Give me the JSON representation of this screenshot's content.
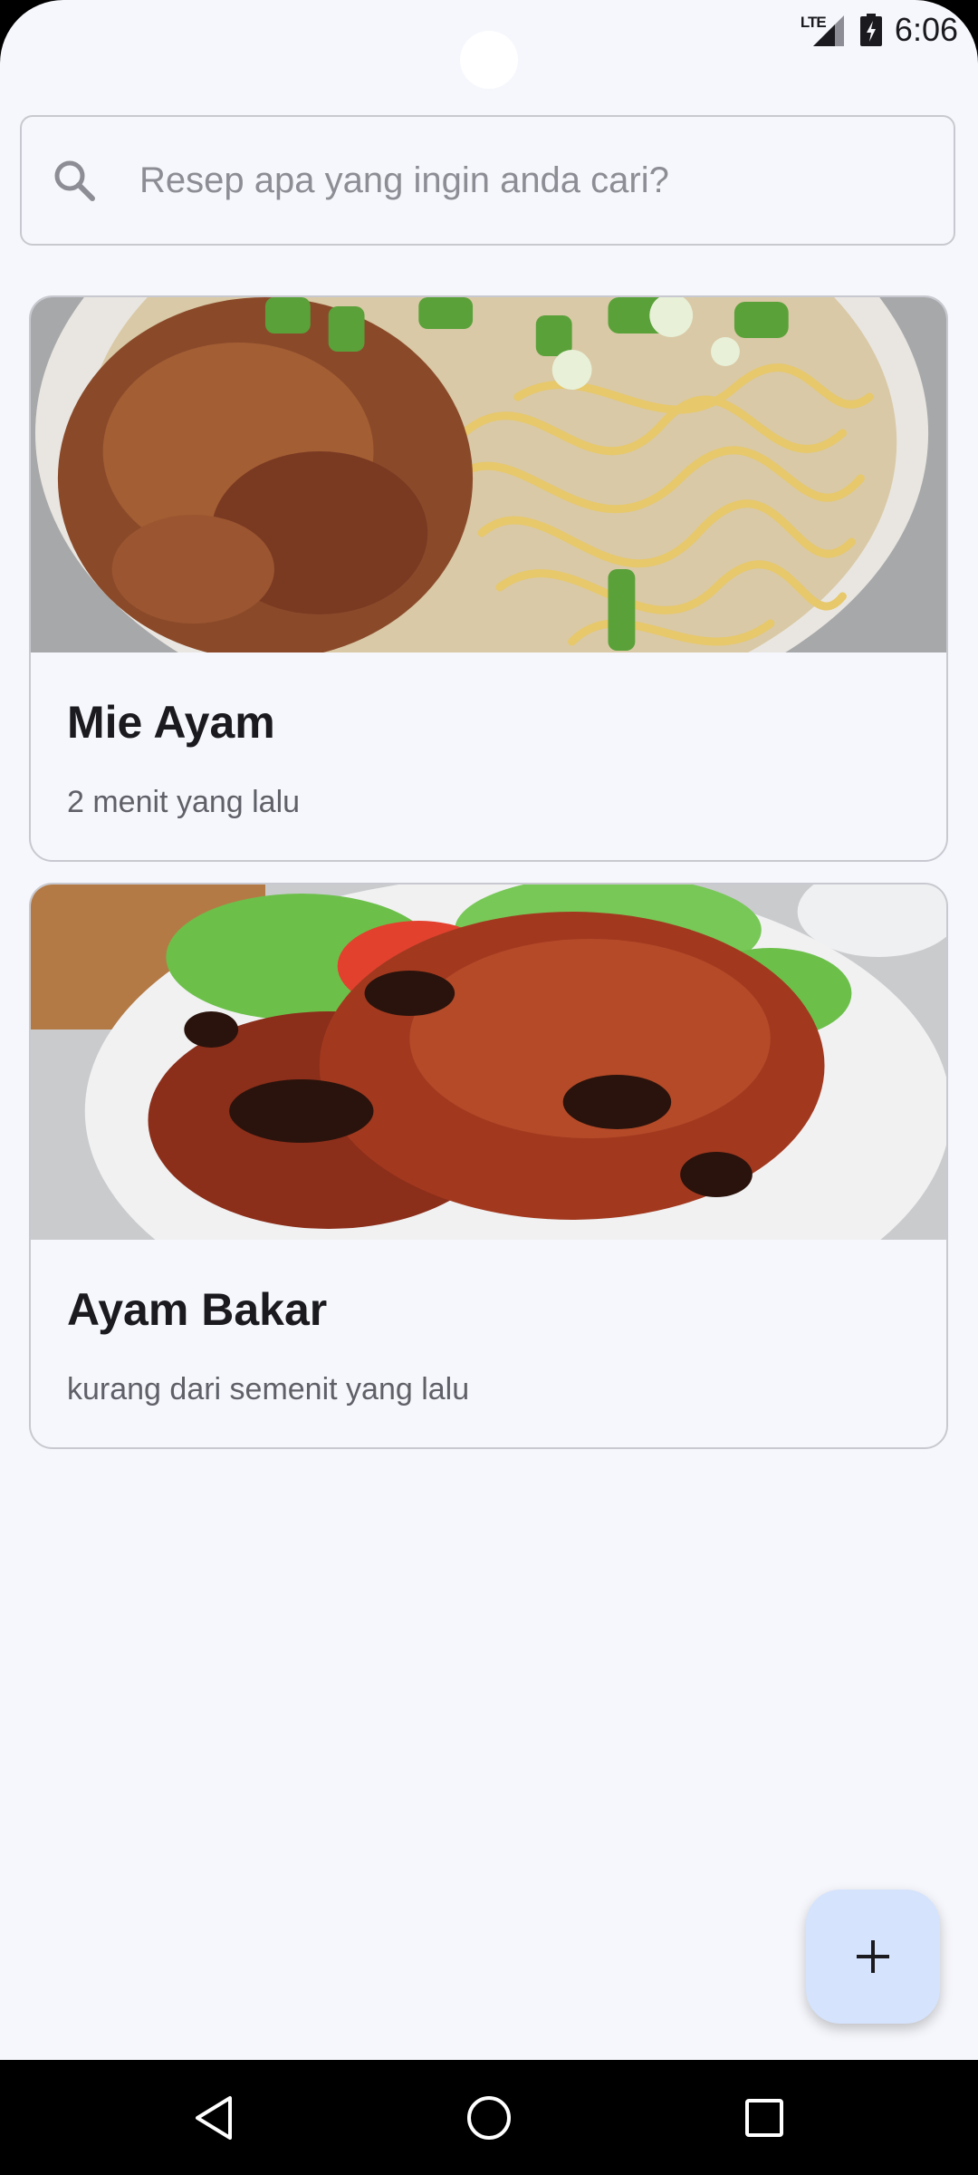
{
  "status_bar": {
    "time": "6:06",
    "network_label": "LTE",
    "signal_icon": "cellular-signal-icon",
    "battery_icon": "battery-charging-icon"
  },
  "search": {
    "placeholder": "Resep apa yang ingin anda cari?",
    "value": "",
    "icon": "search-icon"
  },
  "recipes": [
    {
      "title": "Mie Ayam",
      "time": "2 menit yang lalu",
      "image": "mie-ayam-photo"
    },
    {
      "title": "Ayam Bakar",
      "time": "kurang dari semenit yang lalu",
      "image": "ayam-bakar-photo"
    }
  ],
  "fab": {
    "icon": "plus-icon",
    "color": "#d5e3fd"
  },
  "navigation": {
    "back_icon": "back-triangle-icon",
    "home_icon": "home-circle-icon",
    "recents_icon": "recents-square-icon"
  },
  "colors": {
    "background": "#f6f7fc",
    "text_primary": "#1b1b1f",
    "text_secondary": "#5f6068",
    "outline": "#c8c9d0"
  }
}
